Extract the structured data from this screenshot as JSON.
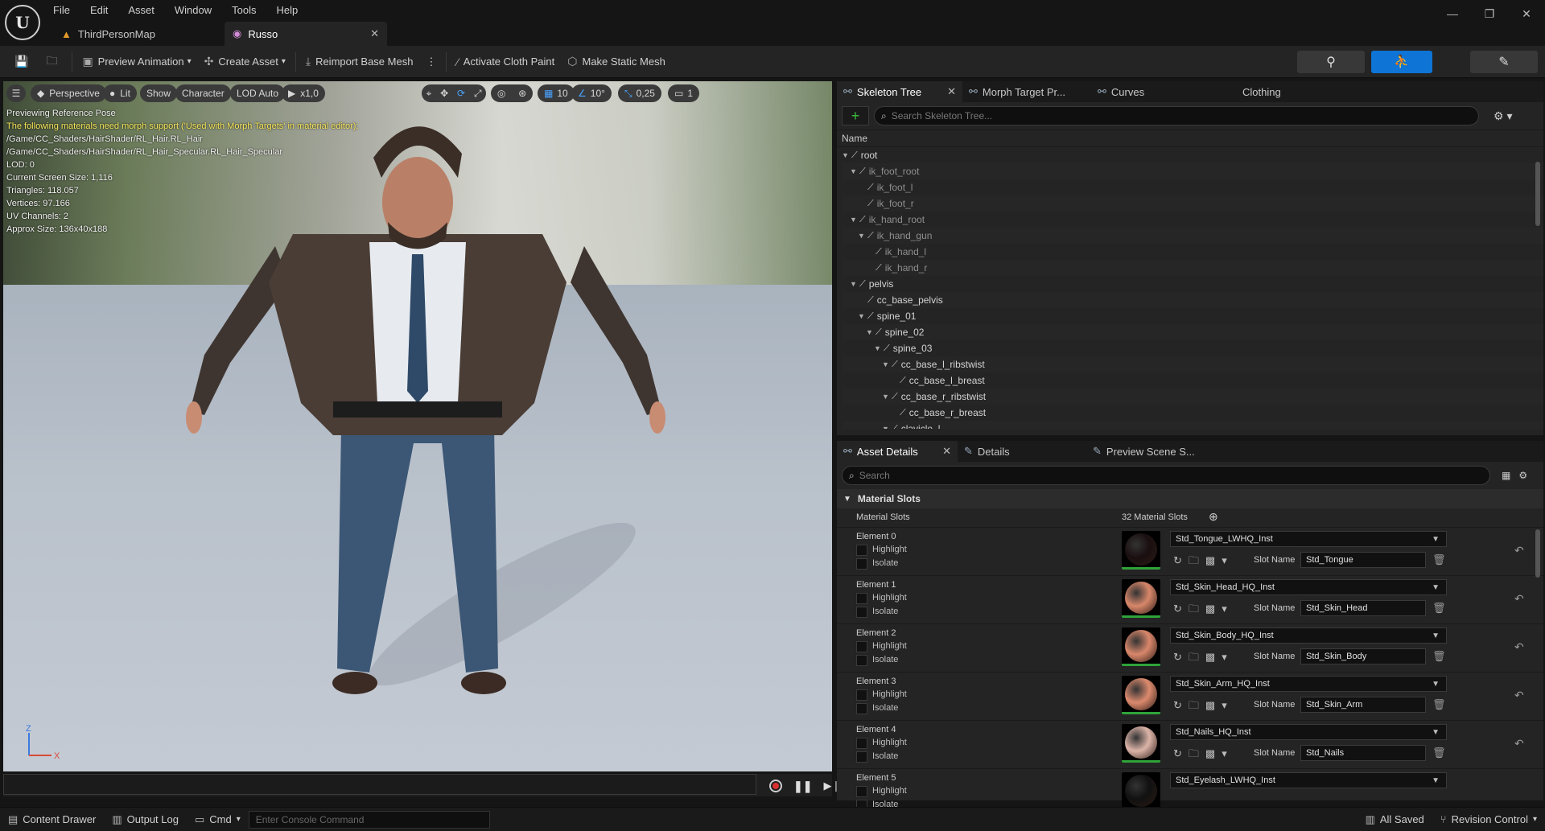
{
  "menu": [
    "File",
    "Edit",
    "Asset",
    "Window",
    "Tools",
    "Help"
  ],
  "tabs": {
    "map": "ThirdPersonMap",
    "asset": "Russo"
  },
  "toolbar": {
    "preview_animation": "Preview Animation",
    "create_asset": "Create Asset",
    "reimport": "Reimport Base Mesh",
    "cloth_paint": "Activate Cloth Paint",
    "static_mesh": "Make Static Mesh"
  },
  "viewport": {
    "perspective": "Perspective",
    "lit": "Lit",
    "show": "Show",
    "character": "Character",
    "lod": "LOD Auto",
    "speed": "x1,0",
    "grid": "10",
    "angle": "10°",
    "scale": "0,25",
    "camera": "1",
    "info": [
      "Previewing Reference Pose",
      "The following materials need morph support ('Used with Morph Targets' in material editor):",
      "/Game/CC_Shaders/HairShader/RL_Hair.RL_Hair",
      "/Game/CC_Shaders/HairShader/RL_Hair_Specular.RL_Hair_Specular",
      "LOD: 0",
      "Current Screen Size: 1,116",
      "Triangles: 118.057",
      "Vertices: 97.166",
      "UV Channels: 2",
      "Approx Size: 136x40x188"
    ],
    "axis_z": "Z",
    "axis_x": "X"
  },
  "skeleton_panel": {
    "tabs": [
      "Skeleton Tree",
      "Morph Target Pr...",
      "Curves",
      "Clothing"
    ],
    "search_placeholder": "Search Skeleton Tree...",
    "column": "Name",
    "bones": [
      {
        "name": "root",
        "dim": false
      },
      {
        "name": "ik_foot_root",
        "dim": true
      },
      {
        "name": "ik_foot_l",
        "dim": true
      },
      {
        "name": "ik_foot_r",
        "dim": true
      },
      {
        "name": "ik_hand_root",
        "dim": true
      },
      {
        "name": "ik_hand_gun",
        "dim": true
      },
      {
        "name": "ik_hand_l",
        "dim": true
      },
      {
        "name": "ik_hand_r",
        "dim": true
      },
      {
        "name": "pelvis",
        "dim": false
      },
      {
        "name": "cc_base_pelvis",
        "dim": false
      },
      {
        "name": "spine_01",
        "dim": false
      },
      {
        "name": "spine_02",
        "dim": false
      },
      {
        "name": "spine_03",
        "dim": false
      },
      {
        "name": "cc_base_l_ribstwist",
        "dim": false
      },
      {
        "name": "cc_base_l_breast",
        "dim": false
      },
      {
        "name": "cc_base_r_ribstwist",
        "dim": false
      },
      {
        "name": "cc_base_r_breast",
        "dim": false
      },
      {
        "name": "clavicle_l",
        "dim": false
      }
    ]
  },
  "details_panel": {
    "tabs": [
      "Asset Details",
      "Details",
      "Preview Scene S..."
    ],
    "search_placeholder": "Search",
    "section": "Material Slots",
    "slots_label": "Material Slots",
    "slots_count": "32 Material Slots",
    "highlight": "Highlight",
    "isolate": "Isolate",
    "slot_name_label": "Slot Name",
    "elements": [
      {
        "label": "Element 0",
        "material": "Std_Tongue_LWHQ_Inst",
        "slot": "Std_Tongue",
        "color": "#1a0f10"
      },
      {
        "label": "Element 1",
        "material": "Std_Skin_Head_HQ_Inst",
        "slot": "Std_Skin_Head",
        "color": "#d8876a"
      },
      {
        "label": "Element 2",
        "material": "Std_Skin_Body_HQ_Inst",
        "slot": "Std_Skin_Body",
        "color": "#d9876b"
      },
      {
        "label": "Element 3",
        "material": "Std_Skin_Arm_HQ_Inst",
        "slot": "Std_Skin_Arm",
        "color": "#dc8a6e"
      },
      {
        "label": "Element 4",
        "material": "Std_Nails_HQ_Inst",
        "slot": "Std_Nails",
        "color": "#dcb4a8"
      },
      {
        "label": "Element 5",
        "material": "Std_Eyelash_LWHQ_Inst",
        "slot": "",
        "color": "#111111"
      }
    ]
  },
  "statusbar": {
    "content_drawer": "Content Drawer",
    "output_log": "Output Log",
    "cmd": "Cmd",
    "console_placeholder": "Enter Console Command",
    "saved": "All Saved",
    "revision": "Revision Control"
  },
  "colors": {
    "accent": "#0e74d6",
    "warning": "#f5e55b"
  }
}
